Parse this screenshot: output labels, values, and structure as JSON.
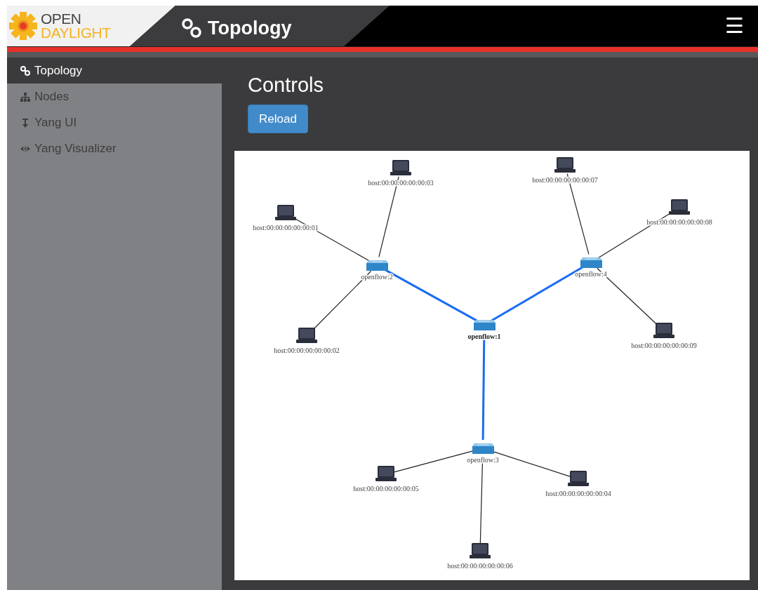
{
  "logo": {
    "line_1": "OPEN",
    "line_2": "DAYLIGHT"
  },
  "header": {
    "title": "Topology",
    "menu_button": "☰"
  },
  "sidebar": {
    "items": [
      {
        "label": "Topology",
        "selected": true
      },
      {
        "label": "Nodes",
        "selected": false
      },
      {
        "label": "Yang UI",
        "selected": false
      },
      {
        "label": "Yang Visualizer",
        "selected": false
      }
    ]
  },
  "main": {
    "heading": "Controls",
    "buttons": [
      "Reload"
    ]
  },
  "topology": {
    "nodes": [
      {
        "kind": "host",
        "label": "host:00:00:00:00:00:03",
        "selected": false
      },
      {
        "kind": "host",
        "label": "host:00:00:00:00:00:07",
        "selected": false
      },
      {
        "kind": "host",
        "label": "host:00:00:00:00:00:01",
        "selected": false
      },
      {
        "kind": "host",
        "label": "host:00:00:00:00:00:08",
        "selected": false
      },
      {
        "kind": "switch",
        "label": "openflow:2",
        "selected": false
      },
      {
        "kind": "switch",
        "label": "openflow:4",
        "selected": false
      },
      {
        "kind": "switch",
        "label": "openflow:1",
        "selected": true
      },
      {
        "kind": "host",
        "label": "host:00:00:00:00:00:02",
        "selected": false
      },
      {
        "kind": "host",
        "label": "host:00:00:00:00:00:09",
        "selected": false
      },
      {
        "kind": "switch",
        "label": "openflow:3",
        "selected": false
      },
      {
        "kind": "host",
        "label": "host:00:00:00:00:00:05",
        "selected": false
      },
      {
        "kind": "host",
        "label": "host:00:00:00:00:00:04",
        "selected": false
      },
      {
        "kind": "host",
        "label": "host:00:00:00:00:00:06",
        "selected": false
      }
    ]
  }
}
